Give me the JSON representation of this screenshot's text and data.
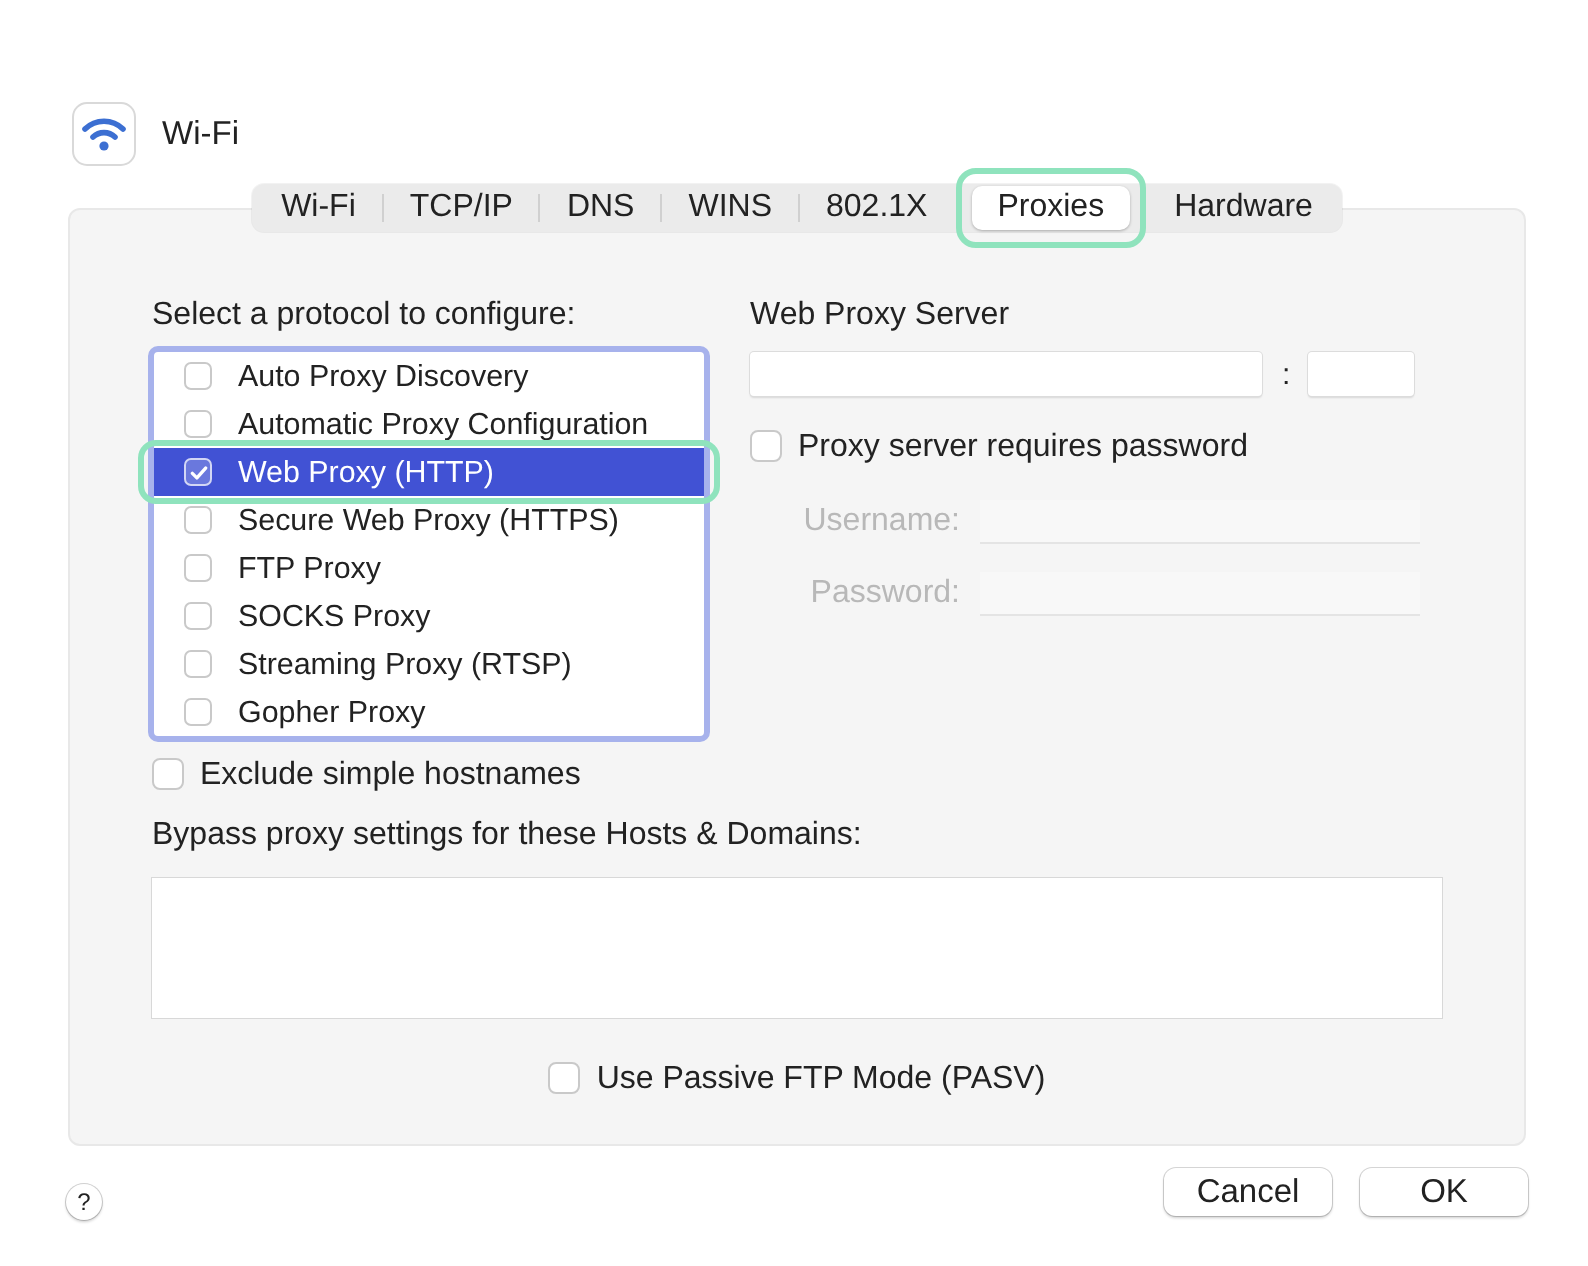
{
  "window": {
    "title": "Wi-Fi"
  },
  "tabs": [
    {
      "label": "Wi-Fi",
      "selected": false,
      "highlighted": false
    },
    {
      "label": "TCP/IP",
      "selected": false,
      "highlighted": false
    },
    {
      "label": "DNS",
      "selected": false,
      "highlighted": false
    },
    {
      "label": "WINS",
      "selected": false,
      "highlighted": false
    },
    {
      "label": "802.1X",
      "selected": false,
      "highlighted": false
    },
    {
      "label": "Proxies",
      "selected": true,
      "highlighted": true
    },
    {
      "label": "Hardware",
      "selected": false,
      "highlighted": false
    }
  ],
  "protocols": {
    "label": "Select a protocol to configure:",
    "items": [
      {
        "label": "Auto Proxy Discovery",
        "checked": false,
        "selected": false,
        "highlighted": false
      },
      {
        "label": "Automatic Proxy Configuration",
        "checked": false,
        "selected": false,
        "highlighted": false
      },
      {
        "label": "Web Proxy (HTTP)",
        "checked": true,
        "selected": true,
        "highlighted": true
      },
      {
        "label": "Secure Web Proxy (HTTPS)",
        "checked": false,
        "selected": false,
        "highlighted": false
      },
      {
        "label": "FTP Proxy",
        "checked": false,
        "selected": false,
        "highlighted": false
      },
      {
        "label": "SOCKS Proxy",
        "checked": false,
        "selected": false,
        "highlighted": false
      },
      {
        "label": "Streaming Proxy (RTSP)",
        "checked": false,
        "selected": false,
        "highlighted": false
      },
      {
        "label": "Gopher Proxy",
        "checked": false,
        "selected": false,
        "highlighted": false
      }
    ]
  },
  "server": {
    "label": "Web Proxy Server",
    "separator": ":"
  },
  "requires_password": {
    "label": "Proxy server requires password",
    "checked": false
  },
  "credentials": [
    {
      "label": "Username:",
      "disabled": true
    },
    {
      "label": "Password:",
      "disabled": true
    }
  ],
  "exclude_simple_hostnames": {
    "label": "Exclude simple hostnames",
    "checked": false
  },
  "bypass": {
    "label": "Bypass proxy settings for these Hosts & Domains:"
  },
  "passive_ftp": {
    "label": "Use Passive FTP Mode (PASV)",
    "checked": false
  },
  "help_button": {
    "label": "?"
  },
  "buttons": [
    {
      "label": "Cancel"
    },
    {
      "label": "OK"
    }
  ]
}
